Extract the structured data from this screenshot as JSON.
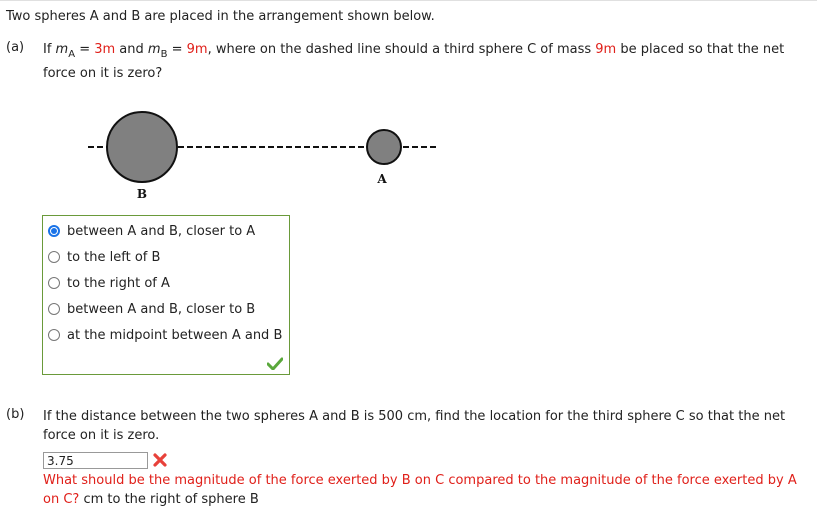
{
  "intro": "Two spheres A and B are placed in the arrangement shown below.",
  "part_a": {
    "label": "(a)",
    "text_if": "If ",
    "mA_var": "m",
    "mA_sub": "A",
    "eq1": " = ",
    "mA_val": "3m",
    "and": " and ",
    "mB_var": "m",
    "mB_sub": "B",
    "eq2": " = ",
    "mB_val": "9m",
    "mid": ", where on the dashed line should a third sphere C of mass ",
    "mC_val": "9m",
    "tail": " be placed so that the net force on it is zero?",
    "diagram": {
      "label_B": "B",
      "label_A": "A"
    },
    "choices": [
      {
        "label": "between A and B, closer to A",
        "selected": true
      },
      {
        "label": "to the left of B",
        "selected": false
      },
      {
        "label": "to the right of A",
        "selected": false
      },
      {
        "label": "between A and B, closer to B",
        "selected": false
      },
      {
        "label": "at the midpoint between A and B",
        "selected": false
      }
    ],
    "status": "correct"
  },
  "part_b": {
    "label": "(b)",
    "text": "If the distance between the two spheres A and B is 500 cm, find the location for the third sphere C so that the net force on it is zero.",
    "input_value": "3.75",
    "status": "incorrect",
    "feedback": "What should be the magnitude of the force exerted by B on C compared to the magnitude of the force exerted by A on C?",
    "unit_text": " cm to the right of sphere B"
  },
  "colors": {
    "highlight": "#e0201a",
    "correct_border": "#6a9a3a",
    "radio_selected": "#1a73e8",
    "sphere_fill": "#808080"
  }
}
